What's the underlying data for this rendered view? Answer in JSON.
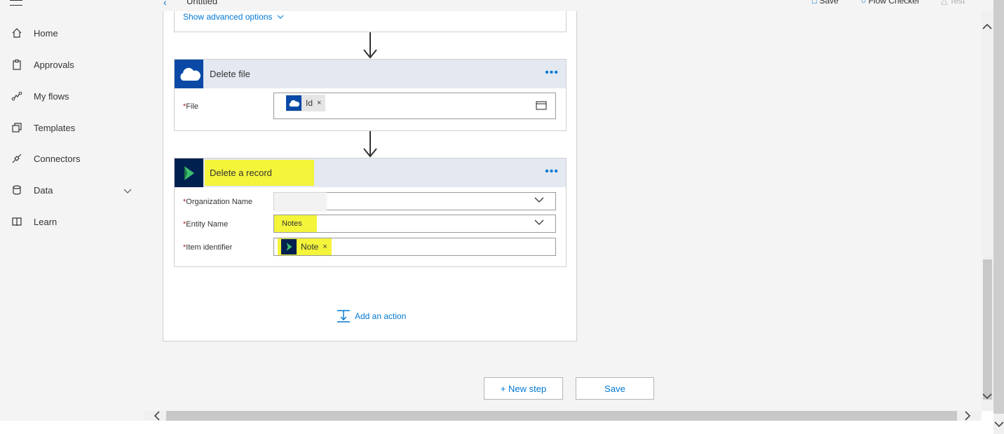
{
  "nav": {
    "items": [
      {
        "label": "Home",
        "icon": "home-icon"
      },
      {
        "label": "Approvals",
        "icon": "clipboard-icon"
      },
      {
        "label": "My flows",
        "icon": "flow-icon"
      },
      {
        "label": "Templates",
        "icon": "templates-icon"
      },
      {
        "label": "Connectors",
        "icon": "plug-icon"
      },
      {
        "label": "Data",
        "icon": "database-icon"
      },
      {
        "label": "Learn",
        "icon": "book-icon"
      }
    ]
  },
  "topbar": {
    "title": "Untitled",
    "save_label": "Save",
    "checker_label": "Flow Checker",
    "test_label": "Test"
  },
  "flow": {
    "prev_card": {
      "advanced_link": "Show advanced options"
    },
    "delete_file": {
      "title": "Delete file",
      "field_label": "File",
      "token": "Id"
    },
    "delete_record": {
      "title": "Delete a record",
      "org_label": "Organization Name",
      "entity_label": "Entity Name",
      "entity_value": "Notes",
      "item_label": "Item identifier",
      "item_token": "Note"
    },
    "add_action": "Add an action"
  },
  "footer": {
    "new_step": "+ New step",
    "save": "Save"
  },
  "colors": {
    "accent": "#0078d4",
    "onedrive": "#0a4aa6",
    "dynamics": "#002050",
    "highlight": "#f4f43b"
  }
}
